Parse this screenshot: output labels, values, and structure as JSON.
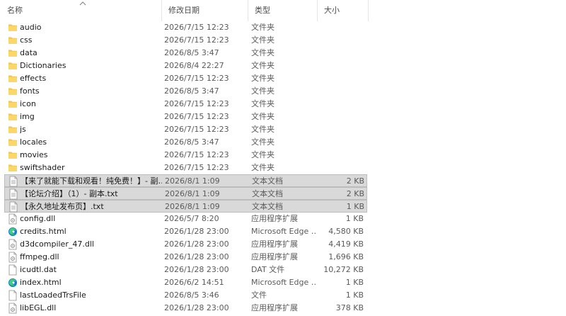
{
  "columns": {
    "name": "名称",
    "date": "修改日期",
    "type": "类型",
    "size": "大小"
  },
  "files": [
    {
      "name": "audio",
      "date": "2026/7/15 12:23",
      "type": "文件夹",
      "size": "",
      "icon": "folder-icon",
      "selected": false
    },
    {
      "name": "css",
      "date": "2026/7/15 12:23",
      "type": "文件夹",
      "size": "",
      "icon": "folder-icon",
      "selected": false
    },
    {
      "name": "data",
      "date": "2026/8/5 3:47",
      "type": "文件夹",
      "size": "",
      "icon": "folder-icon",
      "selected": false
    },
    {
      "name": "Dictionaries",
      "date": "2026/8/4 22:27",
      "type": "文件夹",
      "size": "",
      "icon": "folder-icon",
      "selected": false
    },
    {
      "name": "effects",
      "date": "2026/7/15 12:23",
      "type": "文件夹",
      "size": "",
      "icon": "folder-icon",
      "selected": false
    },
    {
      "name": "fonts",
      "date": "2026/8/5 3:47",
      "type": "文件夹",
      "size": "",
      "icon": "folder-icon",
      "selected": false
    },
    {
      "name": "icon",
      "date": "2026/7/15 12:23",
      "type": "文件夹",
      "size": "",
      "icon": "folder-icon",
      "selected": false
    },
    {
      "name": "img",
      "date": "2026/7/15 12:23",
      "type": "文件夹",
      "size": "",
      "icon": "folder-icon",
      "selected": false
    },
    {
      "name": "js",
      "date": "2026/7/15 12:23",
      "type": "文件夹",
      "size": "",
      "icon": "folder-icon",
      "selected": false
    },
    {
      "name": "locales",
      "date": "2026/8/5 3:47",
      "type": "文件夹",
      "size": "",
      "icon": "folder-icon",
      "selected": false
    },
    {
      "name": "movies",
      "date": "2026/7/15 12:23",
      "type": "文件夹",
      "size": "",
      "icon": "folder-icon",
      "selected": false
    },
    {
      "name": "swiftshader",
      "date": "2026/7/15 12:23",
      "type": "文件夹",
      "size": "",
      "icon": "folder-icon",
      "selected": false
    },
    {
      "name": "【来了就能下载和观看！纯免费！】- 副…",
      "date": "2026/8/1 1:09",
      "type": "文本文档",
      "size": "2 KB",
      "icon": "text-file-icon",
      "selected": true
    },
    {
      "name": "【论坛介绍】（1）- 副本.txt",
      "date": "2026/8/1 1:09",
      "type": "文本文档",
      "size": "2 KB",
      "icon": "text-file-icon",
      "selected": true
    },
    {
      "name": "【永久地址发布页】.txt",
      "date": "2026/8/1 1:09",
      "type": "文本文档",
      "size": "1 KB",
      "icon": "text-file-icon",
      "selected": true
    },
    {
      "name": "config.dll",
      "date": "2026/5/7 8:20",
      "type": "应用程序扩展",
      "size": "1 KB",
      "icon": "dll-file-icon",
      "selected": false
    },
    {
      "name": "credits.html",
      "date": "2026/1/28 23:00",
      "type": "Microsoft Edge …",
      "size": "4,580 KB",
      "icon": "edge-icon",
      "selected": false
    },
    {
      "name": "d3dcompiler_47.dll",
      "date": "2026/1/28 23:00",
      "type": "应用程序扩展",
      "size": "4,419 KB",
      "icon": "dll-file-icon",
      "selected": false
    },
    {
      "name": "ffmpeg.dll",
      "date": "2026/1/28 23:00",
      "type": "应用程序扩展",
      "size": "1,696 KB",
      "icon": "dll-file-icon",
      "selected": false
    },
    {
      "name": "icudtl.dat",
      "date": "2026/1/28 23:00",
      "type": "DAT 文件",
      "size": "10,272 KB",
      "icon": "blank-file-icon",
      "selected": false
    },
    {
      "name": "index.html",
      "date": "2026/6/2 14:51",
      "type": "Microsoft Edge …",
      "size": "1 KB",
      "icon": "edge-icon",
      "selected": false
    },
    {
      "name": "lastLoadedTrsFile",
      "date": "2026/8/5 3:46",
      "type": "文件",
      "size": "1 KB",
      "icon": "blank-file-icon",
      "selected": false
    },
    {
      "name": "libEGL.dll",
      "date": "2026/1/28 23:00",
      "type": "应用程序扩展",
      "size": "378 KB",
      "icon": "dll-file-icon",
      "selected": false
    }
  ]
}
